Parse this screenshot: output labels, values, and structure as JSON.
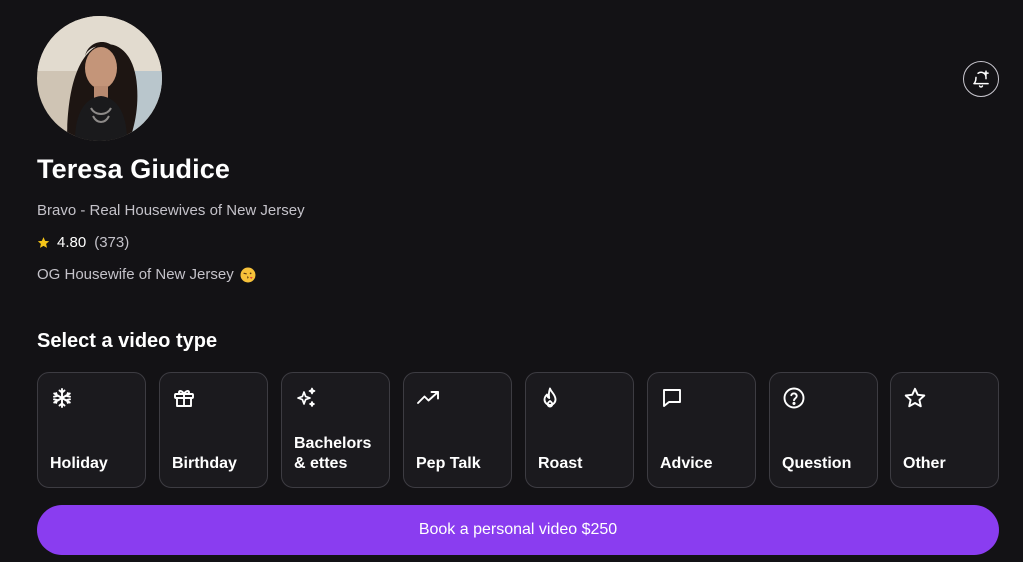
{
  "profile": {
    "name": "Teresa Giudice",
    "subtitle": "Bravo - Real Housewives of New Jersey",
    "rating": "4.80",
    "review_count": "(373)",
    "bio": "OG Housewife of New Jersey",
    "bio_emoji": "face-blowing-kiss"
  },
  "header": {
    "notify_icon": "bell-plus-icon"
  },
  "video_types": {
    "title": "Select a video type",
    "items": [
      {
        "label": "Holiday",
        "icon": "snowflake-icon"
      },
      {
        "label": "Birthday",
        "icon": "gift-icon"
      },
      {
        "label": "Bachelors & ettes",
        "icon": "sparkles-icon"
      },
      {
        "label": "Pep Talk",
        "icon": "trending-up-icon"
      },
      {
        "label": "Roast",
        "icon": "flame-icon"
      },
      {
        "label": "Advice",
        "icon": "message-square-icon"
      },
      {
        "label": "Question",
        "icon": "help-circle-icon"
      },
      {
        "label": "Other",
        "icon": "star-icon"
      }
    ]
  },
  "cta": {
    "book_label": "Book a personal video $250"
  },
  "colors": {
    "background": "#131215",
    "card_border": "#3d3c42",
    "accent": "#8a3df0",
    "star": "#f5c518"
  }
}
